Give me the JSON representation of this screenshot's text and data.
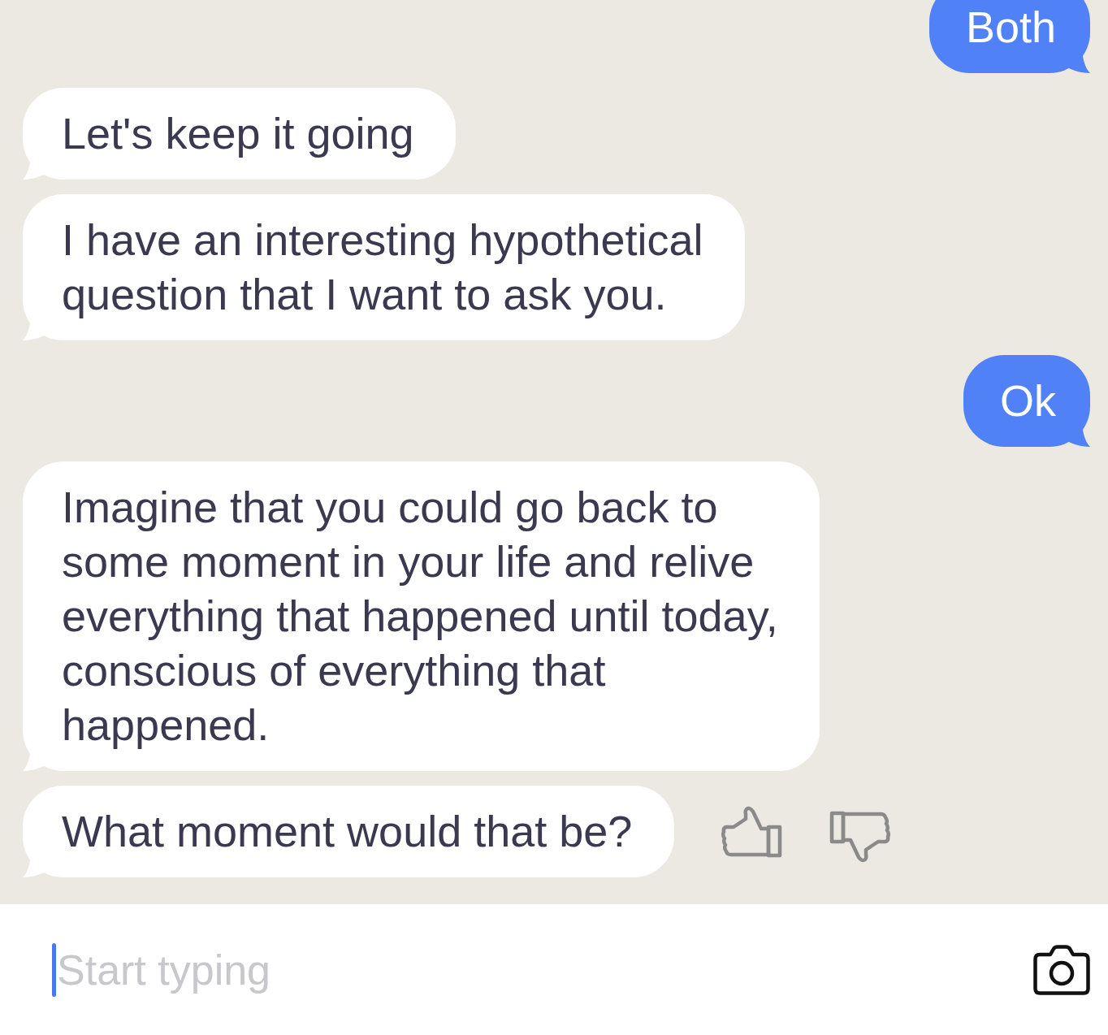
{
  "messages": [
    {
      "kind": "outgoing",
      "text": "Both",
      "rating_buttons": false
    },
    {
      "kind": "incoming",
      "text": "Let's keep it going",
      "rating_buttons": false
    },
    {
      "kind": "incoming",
      "text": "I have an interesting hypothetical question that I want to ask you.",
      "rating_buttons": false
    },
    {
      "kind": "outgoing",
      "text": "Ok",
      "rating_buttons": false
    },
    {
      "kind": "incoming",
      "text": "Imagine that you could go back to some moment in your life and relive everything that happened until today, conscious of everything that happened.",
      "rating_buttons": false
    },
    {
      "kind": "incoming",
      "text": "What moment would that be?",
      "rating_buttons": true
    }
  ],
  "composer": {
    "placeholder": "Start typing",
    "focused": true
  }
}
